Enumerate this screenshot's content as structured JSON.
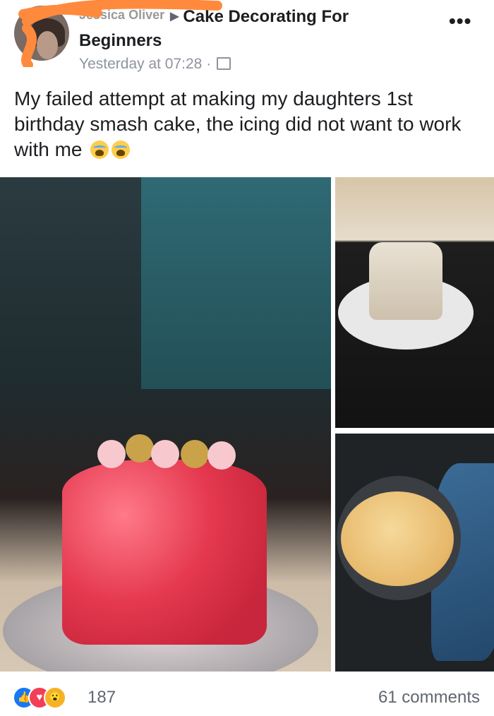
{
  "post": {
    "author_masked": "Jessica Oliver",
    "group_line1": "Cake Decorating For",
    "group_line2": "Beginners",
    "time": "Yesterday at 07:28 ·",
    "more": "•••",
    "text": "My failed attempt at making my daughters 1st birthday smash cake, the icing did not want to work with me"
  },
  "icons": {
    "more": "more-options-icon",
    "privacy": "group-privacy-icon",
    "arrow": "triangle-right-icon",
    "emoji": "crying-face-emoji",
    "like": "like-reaction-icon",
    "love": "love-reaction-icon",
    "wow": "wow-reaction-icon"
  },
  "footer": {
    "reaction_count": "187",
    "comments": "61 comments",
    "like_glyph": "👍",
    "love_glyph": "♥",
    "wow_glyph": "😮"
  },
  "colors": {
    "like": "#1877f2",
    "love": "#f33e58",
    "wow": "#f7b125",
    "redaction": "#ff8a3d"
  }
}
